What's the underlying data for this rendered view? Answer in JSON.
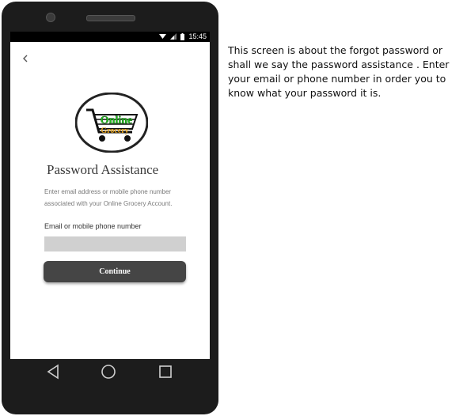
{
  "status_bar": {
    "time": "15:45"
  },
  "screen": {
    "logo_text_line1": "Online",
    "logo_text_line2": "Grocery",
    "title": "Password Assistance",
    "description": "Enter email address or mobile phone number associated with your Online Grocery Account.",
    "field_label": "Email or mobile phone number",
    "field_value": "",
    "continue_label": "Continue"
  },
  "nav": [
    "back-icon",
    "home-icon",
    "recents-icon"
  ],
  "annotation": "This screen is about the forgot password or shall we say the password assistance . Enter your email or phone number in order you to know what your password it is."
}
